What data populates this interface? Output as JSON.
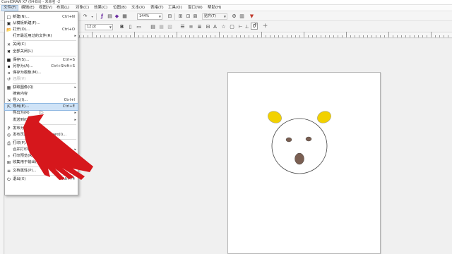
{
  "window": {
    "title": "CorelDRAW X7 (64-Bit) - 未命名 -2"
  },
  "menubar": {
    "items": [
      {
        "label": "文件(F)",
        "active": true
      },
      {
        "label": "编辑(E)"
      },
      {
        "label": "视图(V)"
      },
      {
        "label": "布局(L)"
      },
      {
        "label": "对象(C)"
      },
      {
        "label": "效果(C)"
      },
      {
        "label": "位图(B)"
      },
      {
        "label": "文本(X)"
      },
      {
        "label": "表格(T)"
      },
      {
        "label": "工具(O)"
      },
      {
        "label": "窗口(W)"
      },
      {
        "label": "帮助(H)"
      }
    ]
  },
  "toolbar": {
    "zoom_value": "144%",
    "snap_label": "贴齐(T)",
    "font_size": "12 pt",
    "doc_tab_close": "×",
    "doc_tab_add": "+"
  },
  "file_menu": {
    "rows": [
      {
        "icon": "new-document-icon",
        "glyph": "□",
        "label": "新建(N)...",
        "shortcut": "Ctrl+N"
      },
      {
        "icon": "new-from-template-icon",
        "glyph": "▣",
        "label": "从模板新建(F)..."
      },
      {
        "icon": "open-folder-icon",
        "glyph": "📂",
        "label": "打开(O)...",
        "shortcut": "Ctrl+O"
      },
      {
        "icon": "",
        "glyph": "",
        "label": "打开最近用过的文件(R)",
        "submenu": true
      },
      {
        "sep": true
      },
      {
        "icon": "close-doc-icon",
        "glyph": "✕",
        "label": "关闭(C)"
      },
      {
        "icon": "close-all-icon",
        "glyph": "✖",
        "label": "全部关闭(L)"
      },
      {
        "sep": true
      },
      {
        "icon": "save-icon",
        "glyph": "■",
        "label": "保存(S)...",
        "shortcut": "Ctrl+S"
      },
      {
        "icon": "save-as-icon",
        "glyph": "▪",
        "label": "另存为(A)...",
        "shortcut": "Ctrl+Shift+S"
      },
      {
        "icon": "save-template-icon",
        "glyph": "▫",
        "label": "保存为模板(M)..."
      },
      {
        "icon": "revert-icon",
        "glyph": "↺",
        "label": "还原(V)",
        "disabled": true
      },
      {
        "sep": true
      },
      {
        "icon": "acquire-image-icon",
        "glyph": "▦",
        "label": "获取图像(Q)",
        "submenu": true
      },
      {
        "icon": "",
        "glyph": "",
        "label": "搜索内容"
      },
      {
        "icon": "import-icon",
        "glyph": "⇲",
        "label": "导入(I)...",
        "shortcut": "Ctrl+I"
      },
      {
        "icon": "export-icon",
        "glyph": "⇱",
        "label": "导出(E)...",
        "shortcut": "Ctrl+E",
        "highlight": true
      },
      {
        "icon": "",
        "glyph": "",
        "label": "导出为(R)",
        "submenu": true
      },
      {
        "icon": "",
        "glyph": "",
        "label": "发送到(D)",
        "submenu": true
      },
      {
        "sep": true
      },
      {
        "icon": "publish-pdf-icon",
        "glyph": "P",
        "label": "发布为 PDF(H)..."
      },
      {
        "icon": "publish-web-icon",
        "glyph": "◎",
        "label": "发布页面到 ConceptShare(I)..."
      },
      {
        "sep": true
      },
      {
        "icon": "print-icon",
        "glyph": "⎙",
        "label": "打印(P)..."
      },
      {
        "icon": "",
        "glyph": "",
        "label": "合并打印(G)",
        "submenu": true
      },
      {
        "icon": "print-preview-icon",
        "glyph": "⌕",
        "label": "打印预览(R)..."
      },
      {
        "icon": "collect-output-icon",
        "glyph": "⊞",
        "label": "收集用于输出(U)..."
      },
      {
        "sep": true
      },
      {
        "icon": "doc-properties-icon",
        "glyph": "≡",
        "label": "文档属性(P)..."
      },
      {
        "sep": true
      },
      {
        "icon": "exit-icon",
        "glyph": "⏻",
        "label": "退出(X)",
        "shortcut": "Alt+F4"
      }
    ]
  },
  "drawing": {
    "face_fill": "#ffffff",
    "ear_color": "#f2d100",
    "feature_color": "#7a5f52"
  },
  "annotation": {
    "arrow_color": "#d6171c"
  }
}
